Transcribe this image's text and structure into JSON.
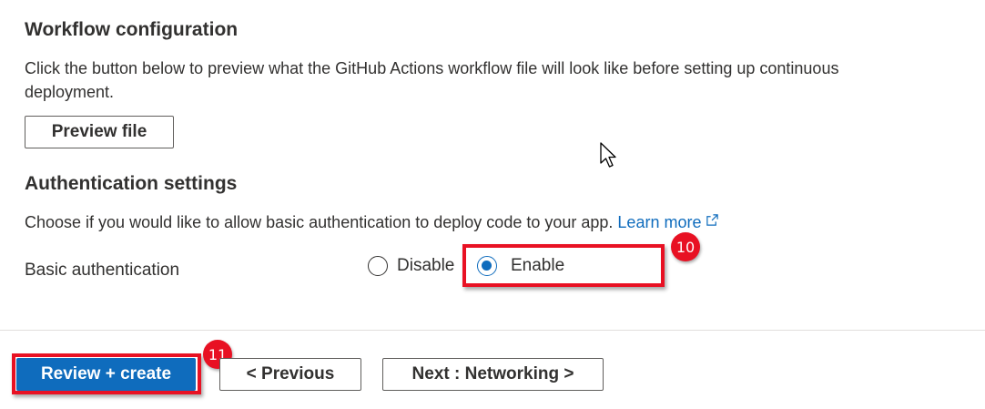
{
  "workflow": {
    "title": "Workflow configuration",
    "description_line1": "Click the button below to preview what the GitHub Actions workflow file will look like before setting up continuous",
    "description_line2": "deployment.",
    "preview_button": "Preview file"
  },
  "auth": {
    "title": "Authentication settings",
    "description": "Choose if you would like to allow basic authentication to deploy code to your app.",
    "learn_more": "Learn more",
    "field_label": "Basic authentication",
    "options": [
      {
        "label": "Disable",
        "selected": false
      },
      {
        "label": "Enable",
        "selected": true
      }
    ]
  },
  "annotations": {
    "step_enable": "10",
    "step_review": "11",
    "highlight_color": "#e81123"
  },
  "footer": {
    "review_create": "Review + create",
    "previous": "< Previous",
    "next": "Next : Networking >"
  },
  "colors": {
    "accent": "#0f6cbd",
    "text": "#323130"
  },
  "icons": [
    "external-link-icon",
    "mouse-pointer-icon"
  ]
}
